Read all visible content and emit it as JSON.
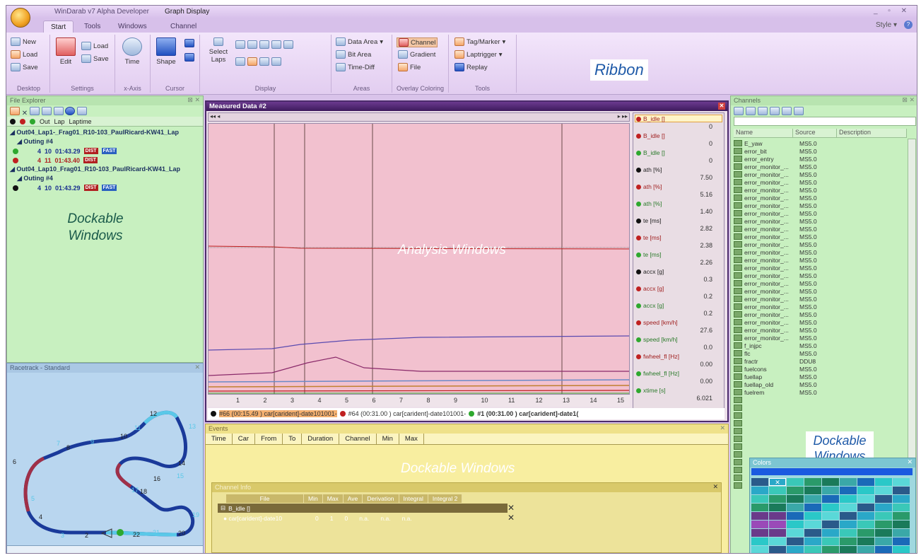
{
  "window": {
    "app_title": "WinDarab v7 Alpha Developer",
    "doc_title": "Graph Display",
    "controls": "_ ▫ ✕"
  },
  "tabs": [
    "Start",
    "Tools",
    "Windows",
    "Channel"
  ],
  "style_label": "Style",
  "ribbon": {
    "groups": {
      "desktop": {
        "label": "Desktop",
        "new": "New",
        "load": "Load",
        "save": "Save"
      },
      "settings": {
        "label": "Settings",
        "edit": "Edit",
        "load": "Load",
        "save": "Save"
      },
      "xaxis": {
        "label": "x-Axis",
        "time": "Time"
      },
      "cursor": {
        "label": "Cursor",
        "shape": "Shape"
      },
      "display": {
        "label": "Display",
        "select_laps": "Select Laps"
      },
      "areas": {
        "label": "Areas",
        "data_area": "Data Area",
        "bit_area": "Bit Area",
        "time_diff": "Time-Diff"
      },
      "overlay": {
        "label": "Overlay Coloring",
        "channel": "Channel",
        "gradient": "Gradient",
        "file": "File"
      },
      "tools": {
        "label": "Tools",
        "tag_marker": "Tag/Marker",
        "laptrigger": "Laptrigger",
        "replay": "Replay"
      }
    }
  },
  "callouts": {
    "ribbon": "Ribbon",
    "analysis": "Analysis Windows",
    "dock_left": "Dockable Windows",
    "dock_bottom": "Dockable Windows",
    "dock_right": "Dockable Windows"
  },
  "file_explorer": {
    "title": "File Explorer",
    "columns": [
      "Out",
      "Lap",
      "Laptime"
    ],
    "tree": [
      {
        "kind": "file",
        "text": "Out04_Lap1-_Frag01_R10-103_PaulRicard-KW41_Lap"
      },
      {
        "kind": "outing",
        "text": "Outing #4"
      },
      {
        "kind": "lap",
        "dot": "#2ea82e",
        "out": "4",
        "lap": "10",
        "time": "01:43.29",
        "tags": [
          "DIST",
          "FAST"
        ],
        "color": "#1a2f8f"
      },
      {
        "kind": "lap",
        "dot": "#c02020",
        "out": "4",
        "lap": "11",
        "time": "01:43.40",
        "tags": [
          "DIST"
        ],
        "color": "#b02020"
      },
      {
        "kind": "file",
        "text": "Out04_Lap10_Frag01_R10-103_PaulRicard-KW41_Lap"
      },
      {
        "kind": "outing",
        "text": "Outing #4"
      },
      {
        "kind": "lap",
        "dot": "#111111",
        "out": "4",
        "lap": "10",
        "time": "01:43.29",
        "tags": [
          "DIST",
          "FAST"
        ],
        "color": "#1a2f8f"
      }
    ]
  },
  "racetrack": {
    "title": "Racetrack - Standard",
    "labels": [
      "12",
      "11",
      "13",
      "7",
      "8",
      "9",
      "10",
      "14",
      "15",
      "16",
      "17",
      "18",
      "6",
      "5",
      "4",
      "3",
      "2",
      "22",
      "21",
      "20",
      "19"
    ]
  },
  "measured": {
    "title": "Measured Data #2",
    "legend": [
      {
        "name": "B_idle []",
        "value": "0",
        "dot": "#c02020"
      },
      {
        "name": "B_idle []",
        "value": "0",
        "dot": "#c02020"
      },
      {
        "name": "B_idle []",
        "value": "0",
        "dot": "#2ea82e"
      },
      {
        "name": "ath [%]",
        "value": "7.50",
        "dot": "#111111"
      },
      {
        "name": "ath [%]",
        "value": "5.16",
        "dot": "#c02020"
      },
      {
        "name": "ath [%]",
        "value": "1.40",
        "dot": "#2ea82e"
      },
      {
        "name": "te [ms]",
        "value": "2.82",
        "dot": "#111111"
      },
      {
        "name": "te [ms]",
        "value": "2.38",
        "dot": "#c02020"
      },
      {
        "name": "te [ms]",
        "value": "2.26",
        "dot": "#2ea82e"
      },
      {
        "name": "accx [g]",
        "value": "0.3",
        "dot": "#111111"
      },
      {
        "name": "accx [g]",
        "value": "0.2",
        "dot": "#c02020"
      },
      {
        "name": "accx [g]",
        "value": "0.2",
        "dot": "#2ea82e"
      },
      {
        "name": "speed [km/h]",
        "value": "27.6",
        "dot": "#c02020"
      },
      {
        "name": "speed [km/h]",
        "value": "0.0",
        "dot": "#2ea82e"
      },
      {
        "name": "fwheel_fl [Hz]",
        "value": "0.00",
        "dot": "#c02020"
      },
      {
        "name": "fwheel_fl [Hz]",
        "value": "0.00",
        "dot": "#2ea82e"
      },
      {
        "name": "xtime [s]",
        "value": "6.021",
        "dot": "#2ea82e"
      }
    ],
    "x_ticks": [
      "1",
      "2",
      "3",
      "4",
      "5",
      "6",
      "7",
      "8",
      "9",
      "10",
      "11",
      "12",
      "13",
      "14",
      "15"
    ],
    "bottom_legend": [
      {
        "text": "#66 (00:15.49 ) car[carident]-date101001-",
        "dot": "#111111"
      },
      {
        "text": "#64 (00:31.00 ) car[carident]-date101001-",
        "dot": "#c02020"
      },
      {
        "text": "#1 (00:31.00 ) car[carident]-date1(",
        "dot": "#2ea82e"
      }
    ]
  },
  "events": {
    "title": "Events",
    "columns": [
      "Time",
      "Car",
      "From",
      "To",
      "Duration",
      "Channel",
      "Min",
      "Max"
    ]
  },
  "channel_info": {
    "title": "Channel Info",
    "columns": [
      "File",
      "Min",
      "Max",
      "Ave",
      "Derivation",
      "Integral",
      "Integral 2"
    ],
    "group": "B_idle []",
    "row": [
      "car[carident]-date10",
      "0",
      "1",
      "0",
      "n.a.",
      "n.a.",
      "n.a."
    ]
  },
  "channels": {
    "title": "Channels",
    "columns": [
      "Name",
      "Source",
      "Description"
    ],
    "rows": [
      [
        "E_yaw",
        "MS5.0"
      ],
      [
        "error_bit",
        "MS5.0"
      ],
      [
        "error_entry",
        "MS5.0"
      ],
      [
        "error_monitor_...",
        "MS5.0"
      ],
      [
        "error_monitor_...",
        "MS5.0"
      ],
      [
        "error_monitor_...",
        "MS5.0"
      ],
      [
        "error_monitor_...",
        "MS5.0"
      ],
      [
        "error_monitor_...",
        "MS5.0"
      ],
      [
        "error_monitor_...",
        "MS5.0"
      ],
      [
        "error_monitor_...",
        "MS5.0"
      ],
      [
        "error_monitor_...",
        "MS5.0"
      ],
      [
        "error_monitor_...",
        "MS5.0"
      ],
      [
        "error_monitor_...",
        "MS5.0"
      ],
      [
        "error_monitor_...",
        "MS5.0"
      ],
      [
        "error_monitor_...",
        "MS5.0"
      ],
      [
        "error_monitor_...",
        "MS5.0"
      ],
      [
        "error_monitor_...",
        "MS5.0"
      ],
      [
        "error_monitor_...",
        "MS5.0"
      ],
      [
        "error_monitor_...",
        "MS5.0"
      ],
      [
        "error_monitor_...",
        "MS5.0"
      ],
      [
        "error_monitor_...",
        "MS5.0"
      ],
      [
        "error_monitor_...",
        "MS5.0"
      ],
      [
        "error_monitor_...",
        "MS5.0"
      ],
      [
        "error_monitor_...",
        "MS5.0"
      ],
      [
        "error_monitor_...",
        "MS5.0"
      ],
      [
        "error_monitor_...",
        "MS5.0"
      ],
      [
        "f_injpc",
        "MS5.0"
      ],
      [
        "flc",
        "MS5.0"
      ],
      [
        "fractr",
        "DDU8"
      ],
      [
        "fuelcons",
        "MS5.0"
      ],
      [
        "fuellap",
        "MS5.0"
      ],
      [
        "fuellap_old",
        "MS5.0"
      ],
      [
        "fuelrem",
        "MS5.0"
      ]
    ]
  },
  "colors_panel": {
    "title": "Colors"
  }
}
